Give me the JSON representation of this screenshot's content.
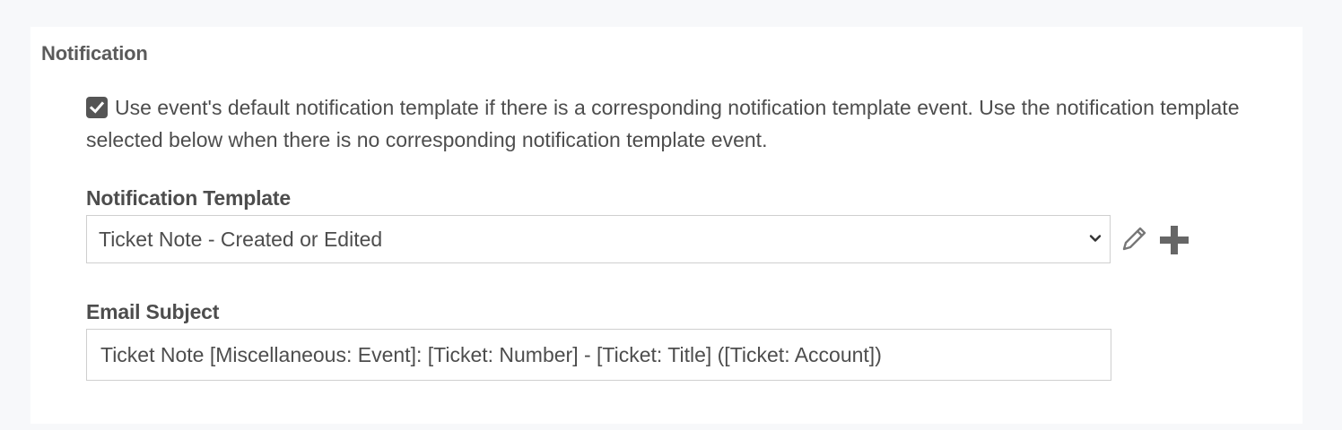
{
  "notification": {
    "section_title": "Notification",
    "use_default_checkbox": {
      "checked": true,
      "label": "Use event's default notification template if there is a corresponding notification template event. Use the notification template selected below when there is no corresponding notification template event."
    },
    "template": {
      "label": "Notification Template",
      "selected": "Ticket Note - Created or Edited"
    },
    "email_subject": {
      "label": "Email Subject",
      "value": "Ticket Note [Miscellaneous: Event]: [Ticket: Number] - [Ticket: Title] ([Ticket: Account])"
    }
  },
  "icons": {
    "checkbox": "checkmark-icon",
    "dropdown": "chevron-down-icon",
    "edit": "pencil-icon",
    "add": "plus-icon"
  },
  "colors": {
    "text": "#4d4d4d",
    "heading": "#5b5b5b",
    "border": "#cfcfcf",
    "icon": "#666666",
    "checkbox": "#555555",
    "background": "#f7f8fa",
    "panel": "#ffffff"
  }
}
